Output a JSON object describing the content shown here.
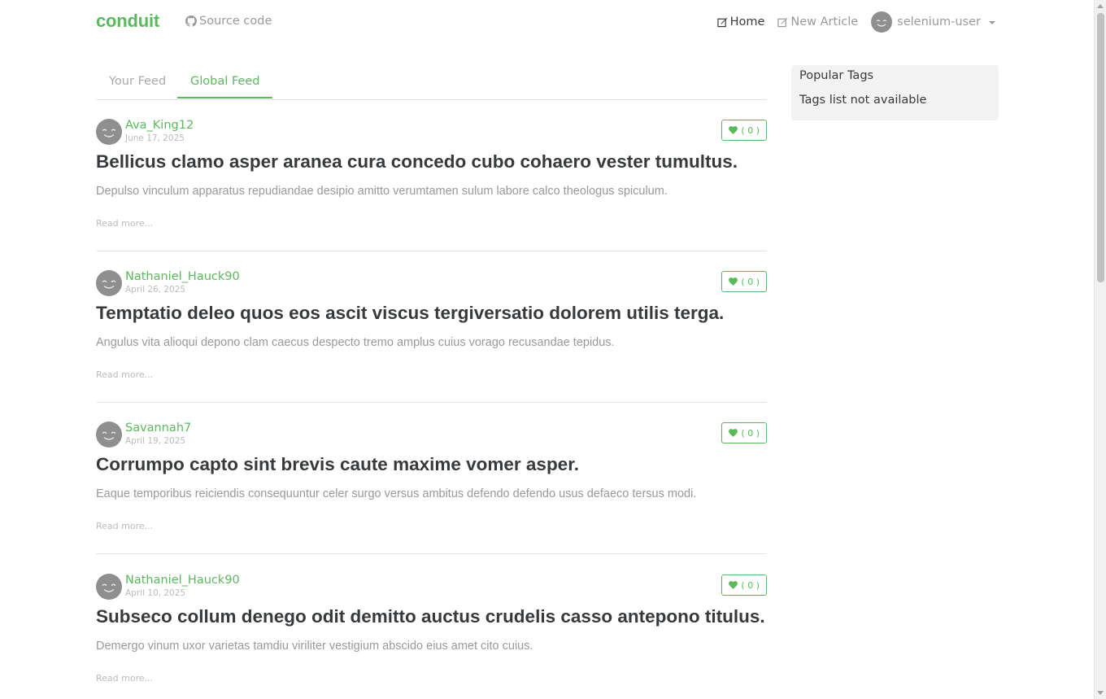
{
  "navbar": {
    "brand": "conduit",
    "source_code": "Source code",
    "home": "Home",
    "new_article": "New Article",
    "username": "selenium-user"
  },
  "feed_tabs": {
    "your_feed": "Your Feed",
    "global_feed": "Global Feed"
  },
  "articles": [
    {
      "author": "Ava_King12",
      "date": "June 17, 2025",
      "favorites": "( 0 )",
      "title": "Bellicus clamo asper aranea cura concedo cubo cohaero vester tumultus.",
      "description": "Depulso vinculum apparatus repudiandae desipio amitto verumtamen sulum labore calco theologus spiculum.",
      "read_more": "Read more..."
    },
    {
      "author": "Nathaniel_Hauck90",
      "date": "April 26, 2025",
      "favorites": "( 0 )",
      "title": "Temptatio deleo quos eos ascit viscus tergiversatio dolorem utilis terga.",
      "description": "Angulus vita alioqui depono clam caecus despecto tremo amplus cuius vorago recusandae tepidus.",
      "read_more": "Read more..."
    },
    {
      "author": "Savannah7",
      "date": "April 19, 2025",
      "favorites": "( 0 )",
      "title": "Corrumpo capto sint brevis caute maxime vomer asper.",
      "description": "Eaque temporibus reiciendis consequuntur celer surgo versus ambitus defendo defendo usus defaeco tersus modi.",
      "read_more": "Read more..."
    },
    {
      "author": "Nathaniel_Hauck90",
      "date": "April 10, 2025",
      "favorites": "( 0 )",
      "title": "Subseco collum denego odit demitto auctus crudelis casso antepono titulus.",
      "description": "Demergo vinum uxor varietas tamdiu viriliter vestigium abscido eius amet cito cuius.",
      "read_more": "Read more..."
    }
  ],
  "sidebar": {
    "title": "Popular Tags",
    "empty_text": "Tags list not available"
  },
  "colors": {
    "brand": "#5cb85c",
    "text": "#373a3c",
    "muted": "#999999",
    "sidebar_bg": "#f3f3f3"
  }
}
